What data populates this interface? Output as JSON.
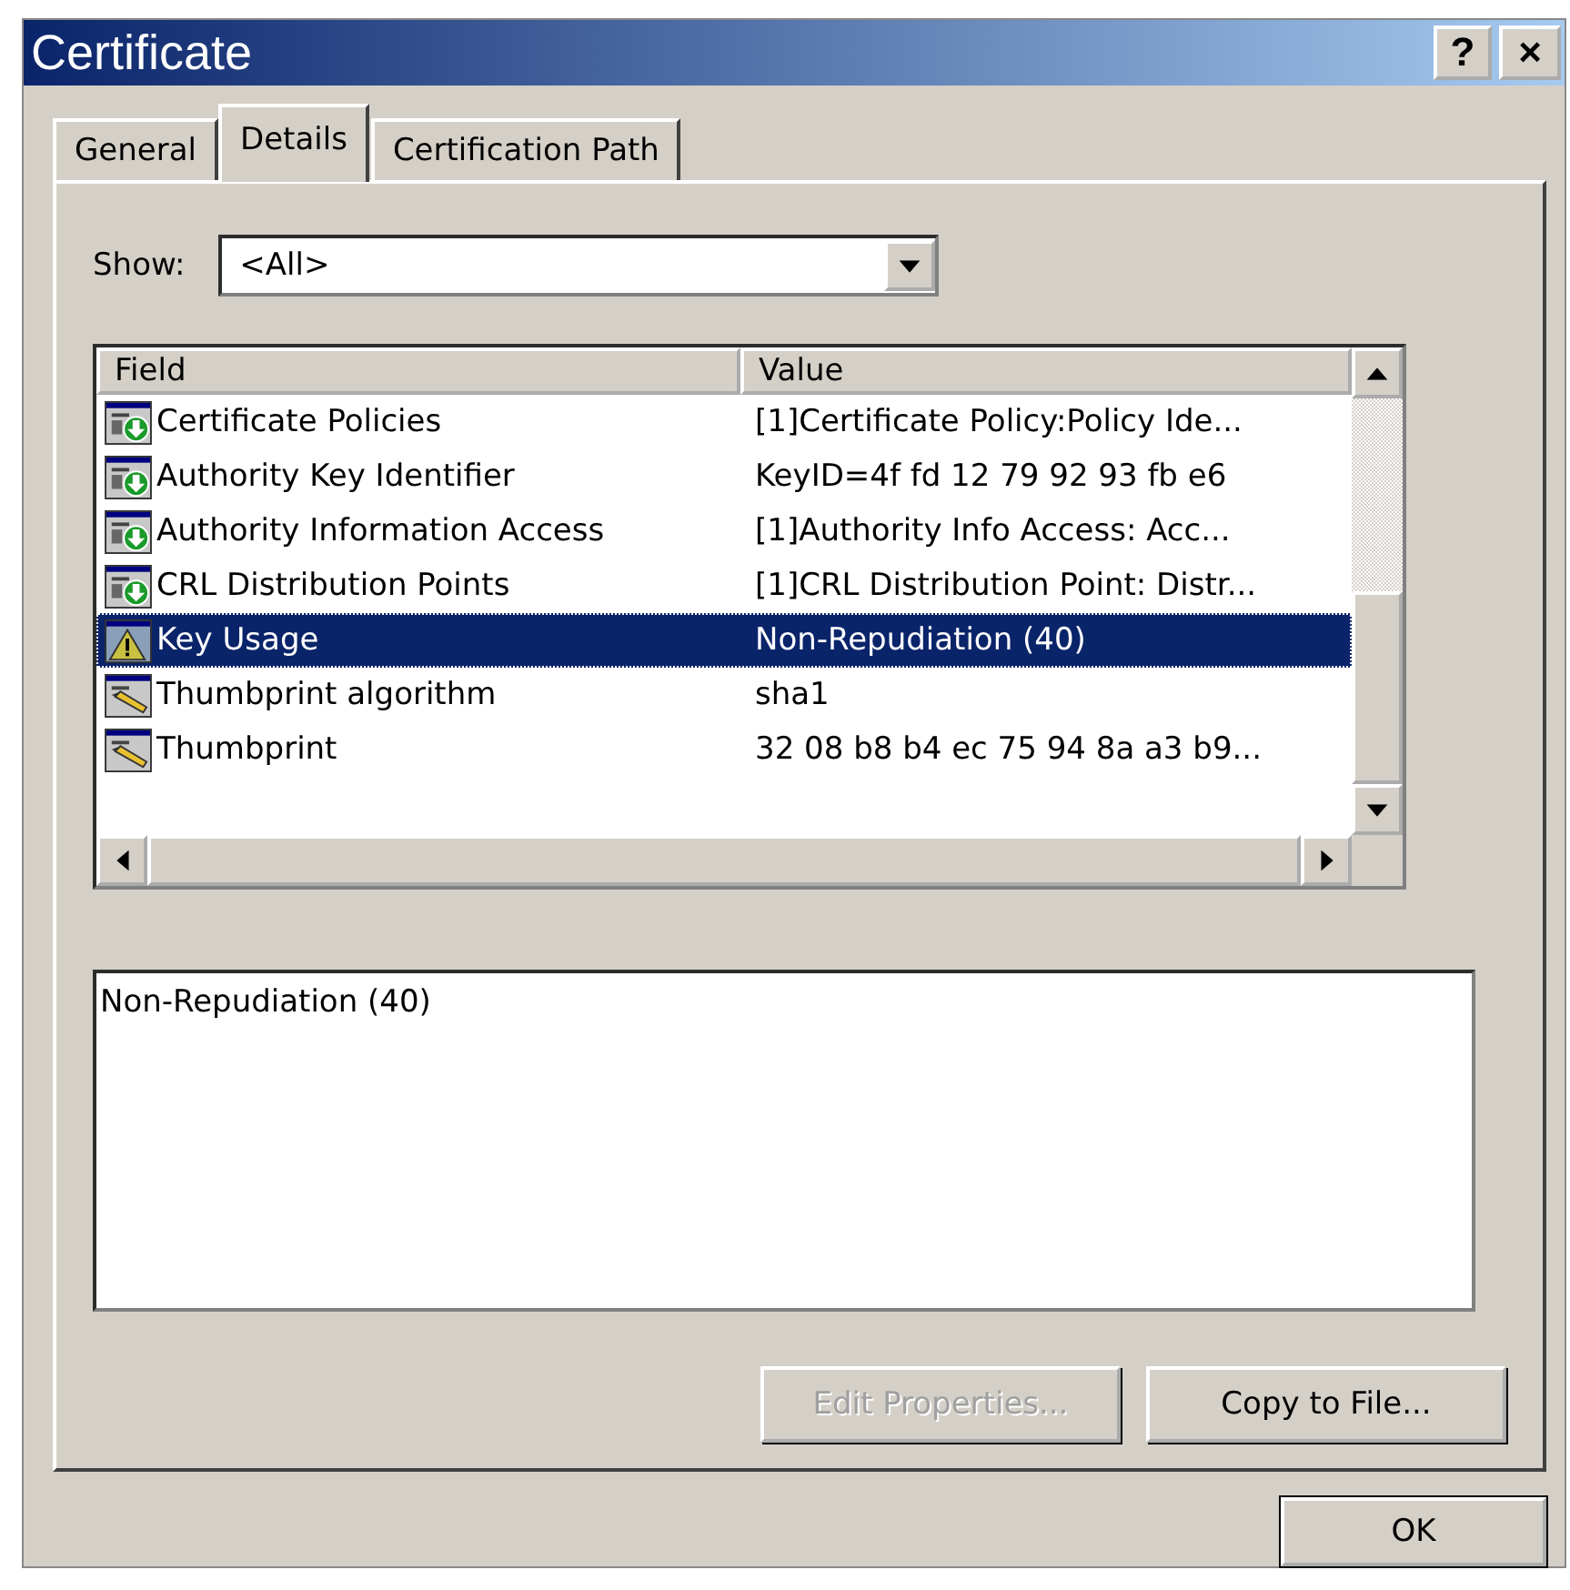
{
  "window": {
    "title": "Certificate",
    "buttons": [
      {
        "kind": "help",
        "label": "?"
      },
      {
        "kind": "close",
        "label": "×"
      }
    ]
  },
  "tabs": [
    {
      "label": "General",
      "selected": false
    },
    {
      "label": "Details",
      "selected": true
    },
    {
      "label": "Certification Path",
      "selected": false
    }
  ],
  "show": {
    "label": "Show:",
    "value": "<All>"
  },
  "table": {
    "columns": [
      "Field",
      "Value"
    ],
    "rows": [
      {
        "kind": "extension",
        "field": "Certificate Policies",
        "value": "[1]Certificate Policy:Policy Ide...",
        "selected": false
      },
      {
        "kind": "extension",
        "field": "Authority Key Identifier",
        "value": "KeyID=4f fd 12 79 92 93 fb e6",
        "selected": false
      },
      {
        "kind": "extension",
        "field": "Authority Information Access",
        "value": "[1]Authority Info Access: Acc...",
        "selected": false
      },
      {
        "kind": "extension",
        "field": "CRL Distribution Points",
        "value": "[1]CRL Distribution Point: Distr...",
        "selected": false
      },
      {
        "kind": "critical",
        "field": "Key Usage",
        "value": "Non-Repudiation (40)",
        "selected": true
      },
      {
        "kind": "property",
        "field": "Thumbprint algorithm",
        "value": "sha1",
        "selected": false
      },
      {
        "kind": "property",
        "field": "Thumbprint",
        "value": "32 08 b8 b4 ec 75 94 8a a3 b9...",
        "selected": false
      }
    ]
  },
  "detail": {
    "text": "Non-Repudiation (40)"
  },
  "buttons": [
    {
      "label": "Edit Properties...",
      "disabled": true
    },
    {
      "label": "Copy to File...",
      "disabled": false
    }
  ],
  "ok_button": {
    "label": "OK"
  }
}
